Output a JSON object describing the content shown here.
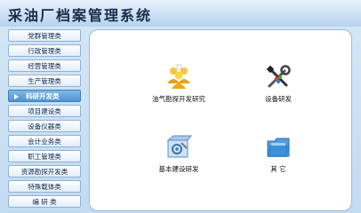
{
  "app": {
    "title": "采油厂档案管理系统"
  },
  "sidebar": {
    "items": [
      {
        "label": "党群管理类"
      },
      {
        "label": "行政管理类"
      },
      {
        "label": "经营管理类"
      },
      {
        "label": "生产管理类"
      },
      {
        "label": "科研开发类",
        "active": true
      },
      {
        "label": "项目建设类"
      },
      {
        "label": "设备仪器类"
      },
      {
        "label": "会计业务类"
      },
      {
        "label": "职工管理类"
      },
      {
        "label": "资源勘探开发类"
      },
      {
        "label": "特殊载体类"
      },
      {
        "label": "编 研 类"
      }
    ]
  },
  "main": {
    "tiles": [
      {
        "label": "油气勘探开发研究",
        "icon": "team-icon"
      },
      {
        "label": "设备研发",
        "icon": "tools-icon"
      },
      {
        "label": "基本建设研发",
        "icon": "blueprint-icon"
      },
      {
        "label": "其     它",
        "icon": "folder-icon"
      }
    ]
  },
  "colors": {
    "accent": "#4f95d0",
    "title_text": "#1d2a4a",
    "nav_text": "#0f2a52"
  }
}
